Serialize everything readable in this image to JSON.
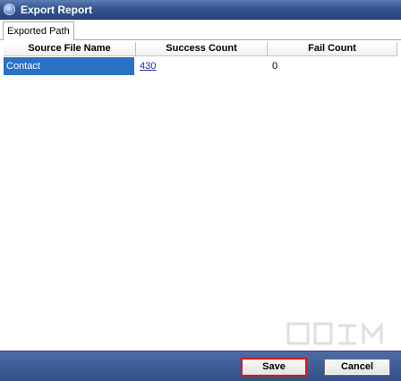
{
  "window": {
    "title": "Export Report"
  },
  "tabs": [
    {
      "label": "Exported Path"
    }
  ],
  "table": {
    "columns": [
      "Source File Name",
      "Success Count",
      "Fail Count"
    ],
    "rows": [
      {
        "source": "Contact",
        "success": "430",
        "fail": "0"
      }
    ]
  },
  "buttons": {
    "save": "Save",
    "cancel": "Cancel"
  },
  "colors": {
    "titlebar": "#34558f",
    "selection": "#2a72c6",
    "save_highlight": "#d51a1a"
  },
  "icons": {
    "title": "app-globe-icon"
  }
}
